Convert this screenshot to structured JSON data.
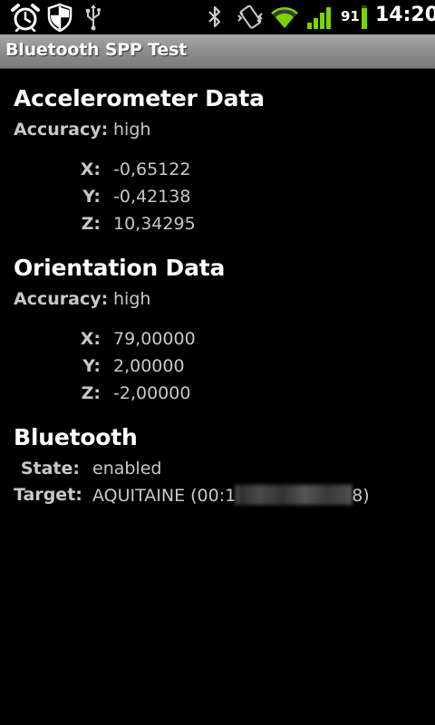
{
  "status_bar": {
    "icons": [
      "alarm-clock-icon",
      "shield-icon",
      "usb-icon",
      "bluetooth-icon",
      "vibrate-icon",
      "wifi-icon",
      "signal-icon",
      "battery-icon"
    ],
    "battery_percent": "91",
    "time": "14:20",
    "colors": {
      "accent_green": "#7ad400"
    }
  },
  "title_bar": {
    "title": "Bluetooth SPP Test"
  },
  "accelerometer": {
    "heading": "Accelerometer Data",
    "accuracy_label": "Accuracy:",
    "accuracy_value": "high",
    "x_label": "X:",
    "x_value": "-0,65122",
    "y_label": "Y:",
    "y_value": "-0,42138",
    "z_label": "Z:",
    "z_value": "10,34295"
  },
  "orientation": {
    "heading": "Orientation Data",
    "accuracy_label": "Accuracy:",
    "accuracy_value": "high",
    "x_label": "X:",
    "x_value": "79,00000",
    "y_label": "Y:",
    "y_value": "2,00000",
    "z_label": "Z:",
    "z_value": "-2,00000"
  },
  "bluetooth": {
    "heading": "Bluetooth",
    "state_label": "State:",
    "state_value": "enabled",
    "target_label": "Target:",
    "target_value_prefix": "AQUITAINE (00:1",
    "target_value_suffix": "8)"
  }
}
